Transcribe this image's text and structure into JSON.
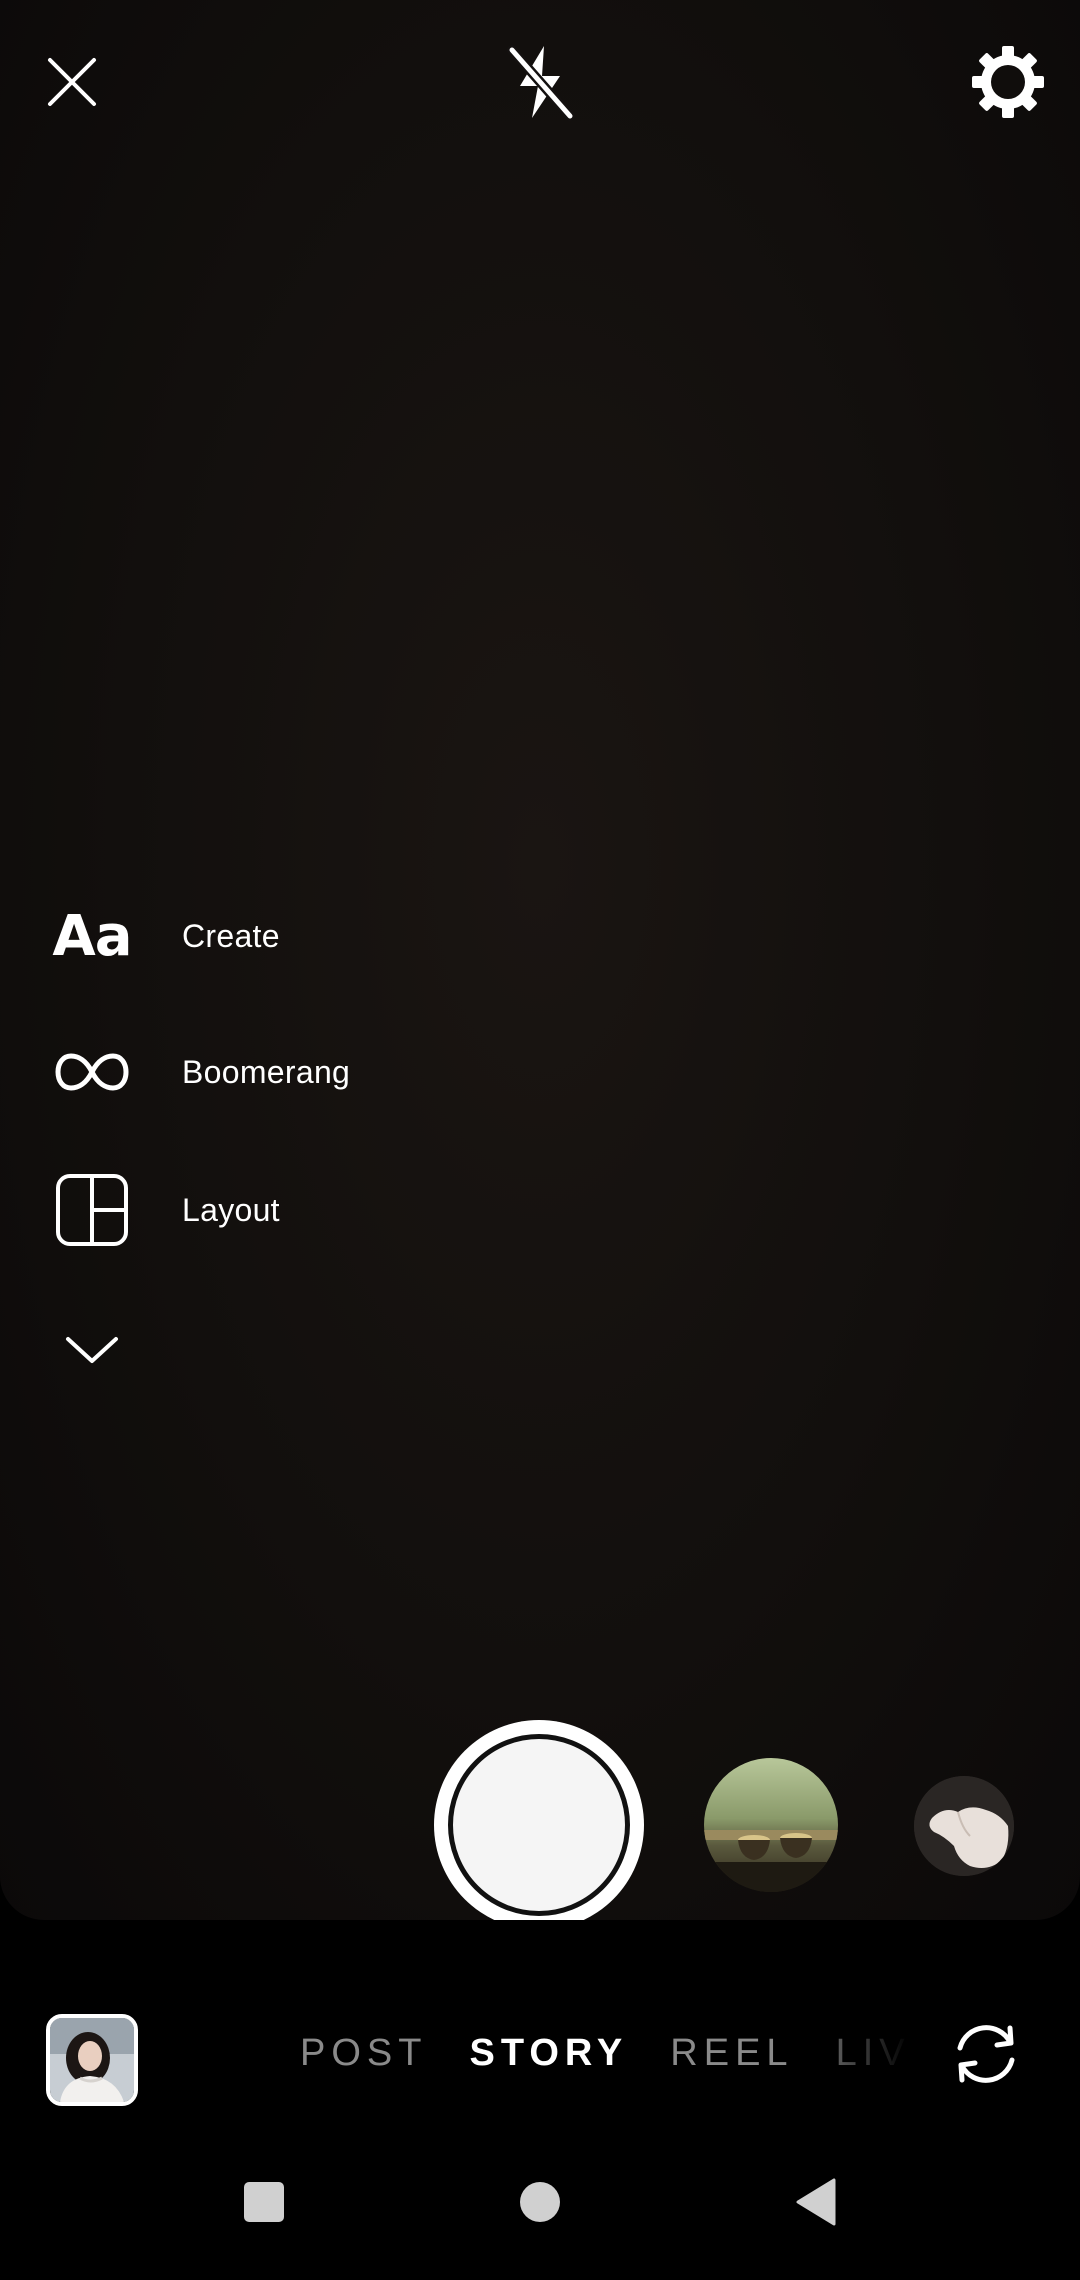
{
  "top_bar": {
    "close_icon": "close-icon",
    "flash_icon": "flash-off-icon",
    "settings_icon": "gear-icon"
  },
  "tools": [
    {
      "icon": "text-aa-icon",
      "icon_text": "Aa",
      "label": "Create"
    },
    {
      "icon": "infinity-icon",
      "label": "Boomerang"
    },
    {
      "icon": "layout-grid-icon",
      "label": "Layout"
    },
    {
      "icon": "chevron-down-icon"
    }
  ],
  "capture": {
    "shutter_icon": "shutter-button",
    "effect_1_icon": "effect-thumbnail-cups",
    "effect_2_icon": "effect-thumbnail-hand"
  },
  "bottom": {
    "gallery_icon": "gallery-thumbnail",
    "modes": [
      "POST",
      "STORY",
      "REEL",
      "LIVE"
    ],
    "active_mode": "STORY",
    "flip_icon": "flip-camera-icon"
  },
  "nav": {
    "recents_icon": "square-icon",
    "home_icon": "circle-icon",
    "back_icon": "triangle-back-icon"
  },
  "colors": {
    "background": "#000000",
    "viewfinder": "#120f0d",
    "text": "#ffffff",
    "inactive_mode": "#8a8a8a"
  }
}
